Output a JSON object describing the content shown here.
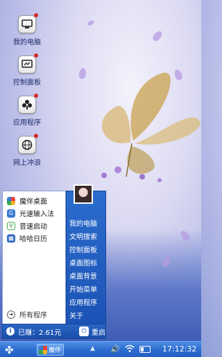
{
  "desktop": {
    "icons": [
      {
        "label": "我的电脑",
        "icon": "computer-icon"
      },
      {
        "label": "控制面板",
        "icon": "control-panel-icon"
      },
      {
        "label": "应用程序",
        "icon": "apps-icon"
      },
      {
        "label": "网上冲浪",
        "icon": "globe-icon"
      }
    ]
  },
  "start_menu": {
    "programs": [
      {
        "label": "魔伴桌面",
        "icon": "pinwheel-icon",
        "color": "#f0a020"
      },
      {
        "label": "光速输入法",
        "icon": "input-method-icon",
        "color": "#3a7bd5"
      },
      {
        "label": "音速启动",
        "icon": "launcher-v-icon",
        "color": "#4caf50"
      },
      {
        "label": "哈哈日历",
        "icon": "calendar-icon",
        "color": "#3a6fc4"
      }
    ],
    "all_programs": "所有程序",
    "right_items": [
      "我的电脑",
      "文明搜索",
      "控制面板",
      "桌面图标",
      "桌面背景",
      "开始菜单",
      "应用程序",
      "关于"
    ],
    "earned": "已赚：2.61元",
    "restart": "重启"
  },
  "taskbar": {
    "app_label": "魔伴",
    "clock": "17:12:32",
    "battery_level": 0.3
  }
}
